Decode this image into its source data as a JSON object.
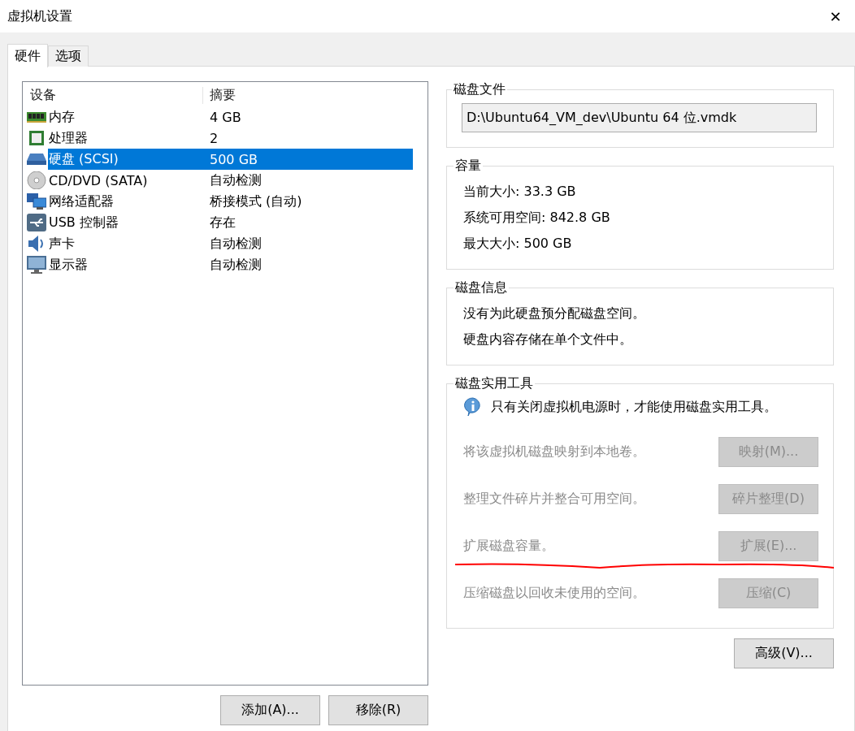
{
  "window": {
    "title": "虚拟机设置",
    "close": "✕"
  },
  "tabs": [
    {
      "label": "硬件",
      "selected": true
    },
    {
      "label": "选项",
      "selected": false
    }
  ],
  "devices": {
    "columns": [
      "设备",
      "摘要"
    ],
    "rows": [
      {
        "kind": "memory",
        "name": "内存",
        "summary": "4 GB",
        "selected": false
      },
      {
        "kind": "cpu",
        "name": "处理器",
        "summary": "2",
        "selected": false
      },
      {
        "kind": "disk",
        "name": "硬盘 (SCSI)",
        "summary": "500 GB",
        "selected": true
      },
      {
        "kind": "cd",
        "name": "CD/DVD (SATA)",
        "summary": "自动检测",
        "selected": false
      },
      {
        "kind": "network",
        "name": "网络适配器",
        "summary": "桥接模式 (自动)",
        "selected": false
      },
      {
        "kind": "usb",
        "name": "USB 控制器",
        "summary": "存在",
        "selected": false
      },
      {
        "kind": "sound",
        "name": "声卡",
        "summary": "自动检测",
        "selected": false
      },
      {
        "kind": "display",
        "name": "显示器",
        "summary": "自动检测",
        "selected": false
      }
    ]
  },
  "device_buttons": [
    "添加(A)...",
    "移除(R)"
  ],
  "disk_file": {
    "title": "磁盘文件",
    "value": "D:\\Ubuntu64_VM_dev\\Ubuntu 64 位.vmdk"
  },
  "capacity": {
    "title": "容量",
    "lines": [
      {
        "label": "当前大小:",
        "value": "33.3 GB"
      },
      {
        "label": "系统可用空间:",
        "value": "842.8 GB"
      },
      {
        "label": "最大大小:",
        "value": "500 GB"
      }
    ]
  },
  "disk_info": {
    "title": "磁盘信息",
    "lines": [
      "没有为此硬盘预分配磁盘空间。",
      "硬盘内容存储在单个文件中。"
    ]
  },
  "disk_tools": {
    "title": "磁盘实用工具",
    "notice": "只有关闭虚拟机电源时，才能使用磁盘实用工具。",
    "tools": [
      {
        "description": "将该虚拟机磁盘映射到本地卷。",
        "button": "映射(M)...",
        "disabled": true,
        "annotated": false
      },
      {
        "description": "整理文件碎片并整合可用空间。",
        "button": "碎片整理(D)",
        "disabled": true,
        "annotated": false
      },
      {
        "description": "扩展磁盘容量。",
        "button": "扩展(E)...",
        "disabled": true,
        "annotated": true
      },
      {
        "description": "压缩磁盘以回收未使用的空间。",
        "button": "压缩(C)",
        "disabled": true,
        "annotated": false
      }
    ]
  },
  "advanced_button": "高级(V)..."
}
